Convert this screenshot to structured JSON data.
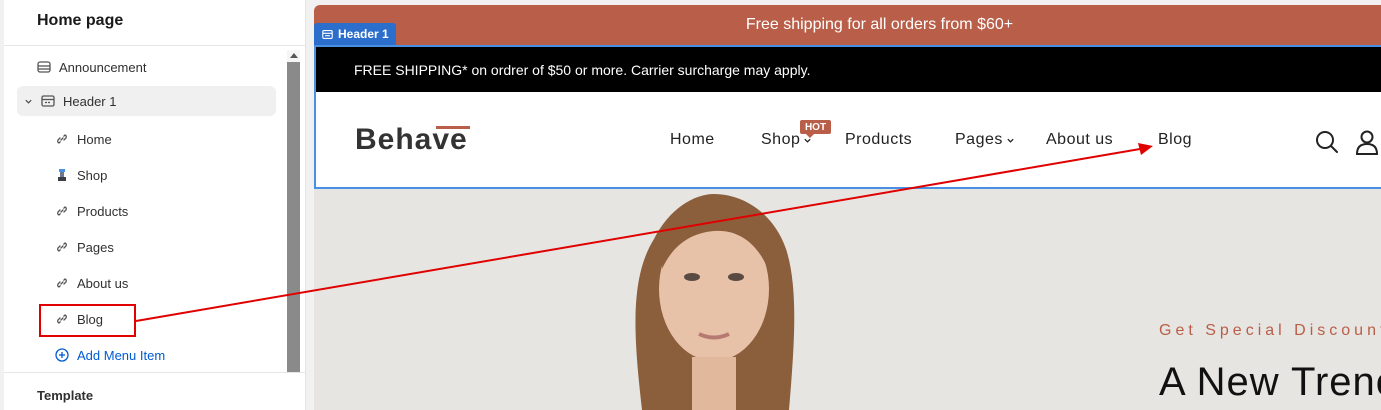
{
  "sidebar": {
    "title": "Home page",
    "items": [
      {
        "label": "Announcement",
        "icon": "announcement-icon"
      },
      {
        "label": "Header 1",
        "icon": "header-section-icon"
      },
      {
        "label": "Home",
        "icon": "link-icon"
      },
      {
        "label": "Shop",
        "icon": "shop-icon"
      },
      {
        "label": "Products",
        "icon": "link-icon"
      },
      {
        "label": "Pages",
        "icon": "link-icon"
      },
      {
        "label": "About us",
        "icon": "link-icon"
      },
      {
        "label": "Blog",
        "icon": "link-icon"
      }
    ],
    "add_label": "Add Menu Item",
    "template_label": "Template"
  },
  "preview": {
    "announcement": "Free shipping for all orders from $60+",
    "header_badge": "Header 1",
    "promo": "FREE SHIPPING* on ordrer of $50 or more. Carrier surcharge may apply.",
    "logo": "Behave",
    "nav": [
      "Home",
      "Shop",
      "Products",
      "Pages",
      "About us",
      "Blog"
    ],
    "hot_badge": "HOT",
    "hero_sub": "Get Special Discount o",
    "hero_title": "A New Trenc"
  },
  "colors": {
    "accent": "#b95e48",
    "selection": "#2c6ecb",
    "annotation": "#e00000",
    "link": "#005bd3"
  }
}
